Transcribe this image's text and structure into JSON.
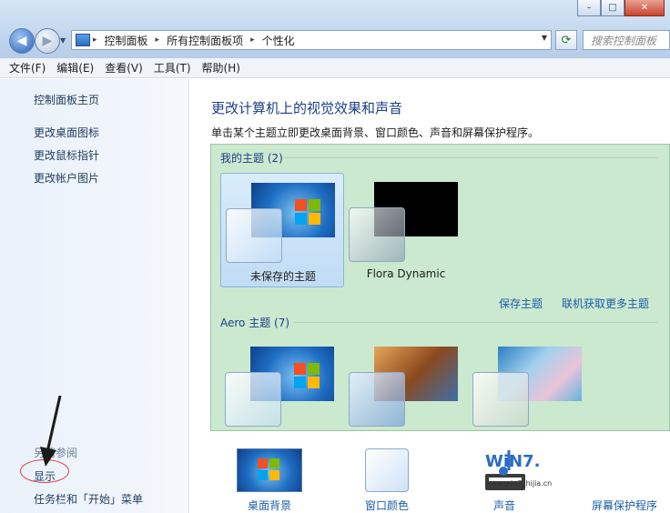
{
  "window": {
    "minimize": "–",
    "maximize": "□",
    "close": "✕"
  },
  "address": {
    "crumbs": [
      "控制面板",
      "所有控制面板项",
      "个性化"
    ],
    "search_placeholder": "搜索控制面板"
  },
  "menu": [
    "文件(F)",
    "编辑(E)",
    "查看(V)",
    "工具(T)",
    "帮助(H)"
  ],
  "left": {
    "home": "控制面板主页",
    "links": [
      "更改桌面图标",
      "更改鼠标指针",
      "更改帐户图片"
    ],
    "see_also": "另请参阅",
    "display": "显示",
    "taskbar": "任务栏和「开始」菜单"
  },
  "main": {
    "title": "更改计算机上的视觉效果和声音",
    "subtitle": "单击某个主题立即更改桌面背景、窗口颜色、声音和屏幕保护程序。",
    "my_themes": "我的主题 (2)",
    "themes": [
      "未保存的主题",
      "Flora Dynamic"
    ],
    "save_theme": "保存主题",
    "get_more": "联机获取更多主题",
    "aero_themes": "Aero 主题 (7)"
  },
  "bottom": [
    "桌面背景",
    "窗口颜色",
    "声音",
    "屏幕保护程序"
  ],
  "watermark": {
    "brand": "WiN7.",
    "url": "www.win7zhijia.cn"
  },
  "colors": {
    "accent": "#1d3f86",
    "link": "#1d5fa8",
    "theme_bg": "#cbe9cf",
    "annotation": "#e23b3b"
  }
}
